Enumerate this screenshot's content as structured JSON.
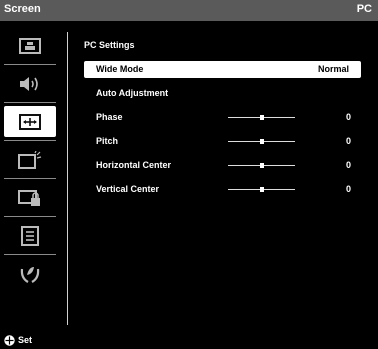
{
  "header": {
    "title": "Screen",
    "source": "PC"
  },
  "sidebar": {
    "items": [
      {
        "icon": "picture-icon",
        "active": false
      },
      {
        "icon": "sound-icon",
        "active": false
      },
      {
        "icon": "screen-adjust-icon",
        "active": true
      },
      {
        "icon": "setup-icon",
        "active": false
      },
      {
        "icon": "lock-icon",
        "active": false
      },
      {
        "icon": "list-icon",
        "active": false
      },
      {
        "icon": "support-icon",
        "active": false
      }
    ]
  },
  "panel": {
    "title": "PC Settings",
    "items": [
      {
        "label": "Wide Mode",
        "value": "Normal",
        "selected": true,
        "type": "option"
      },
      {
        "label": "Auto Adjustment",
        "value": "",
        "selected": false,
        "type": "action"
      },
      {
        "label": "Phase",
        "value": "0",
        "selected": false,
        "type": "slider",
        "level": 0.5
      },
      {
        "label": "Pitch",
        "value": "0",
        "selected": false,
        "type": "slider",
        "level": 0.5
      },
      {
        "label": "Horizontal Center",
        "value": "0",
        "selected": false,
        "type": "slider",
        "level": 0.5
      },
      {
        "label": "Vertical Center",
        "value": "0",
        "selected": false,
        "type": "slider",
        "level": 0.5
      }
    ]
  },
  "footer": {
    "icon": "dpad-icon",
    "label": "Set"
  }
}
